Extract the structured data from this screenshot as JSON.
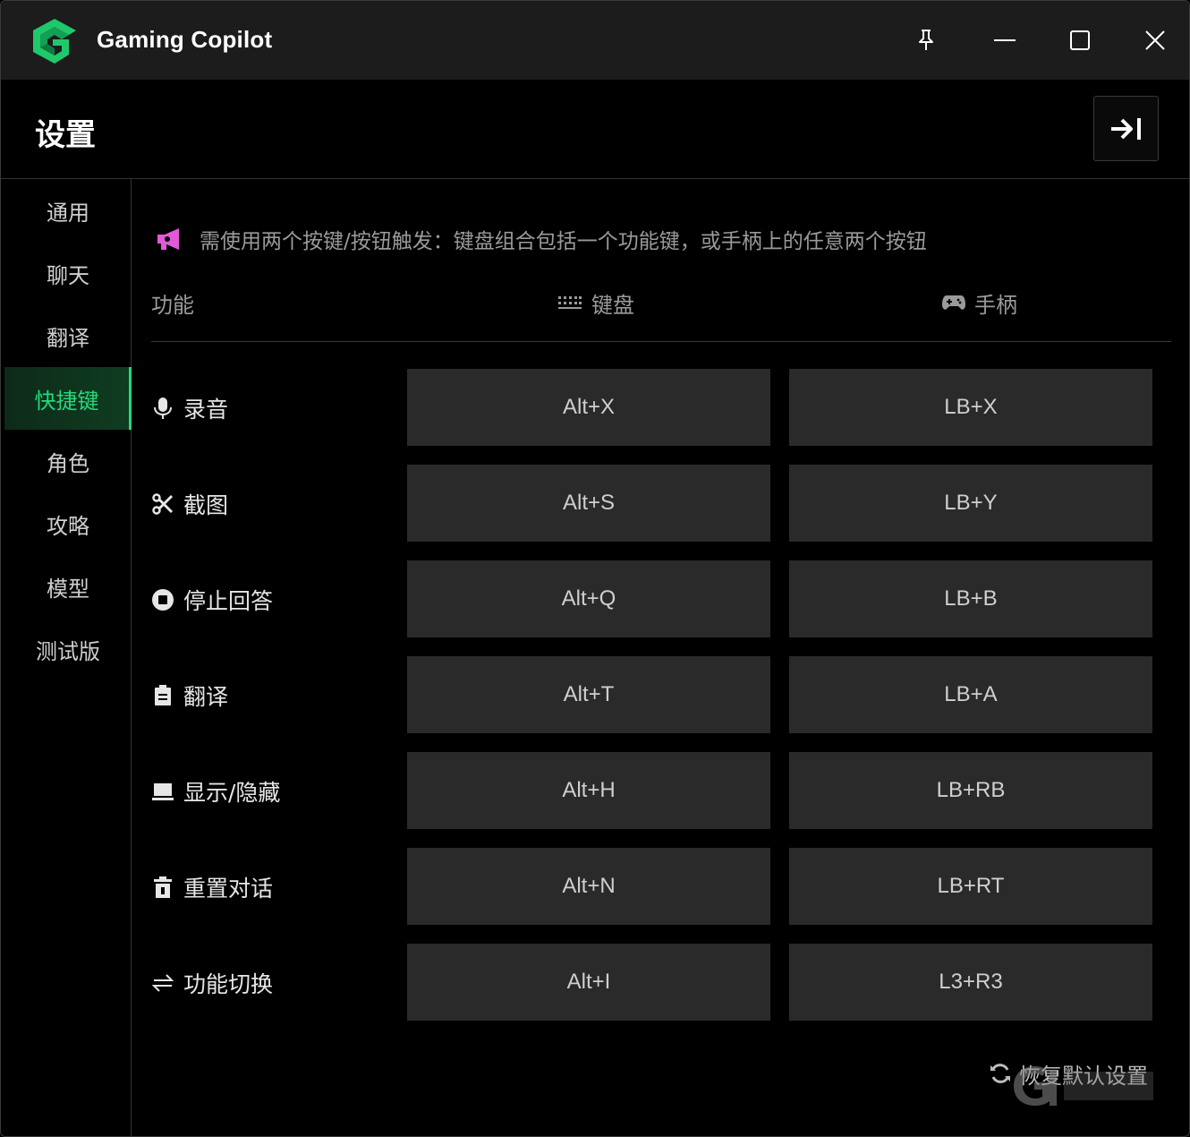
{
  "app": {
    "title": "Gaming Copilot"
  },
  "header": {
    "title": "设置"
  },
  "sidebar": {
    "items": [
      {
        "label": "通用"
      },
      {
        "label": "聊天"
      },
      {
        "label": "翻译"
      },
      {
        "label": "快捷键",
        "active": true
      },
      {
        "label": "角色"
      },
      {
        "label": "攻略"
      },
      {
        "label": "模型"
      },
      {
        "label": "测试版"
      }
    ]
  },
  "notice": {
    "text": "需使用两个按键/按钮触发：键盘组合包括一个功能键，或手柄上的任意两个按钮"
  },
  "columns": {
    "function": "功能",
    "keyboard": "键盘",
    "gamepad": "手柄"
  },
  "shortcuts": [
    {
      "label": "录音",
      "icon": "microphone-icon",
      "keyboard": "Alt+X",
      "gamepad": "LB+X"
    },
    {
      "label": "截图",
      "icon": "scissors-icon",
      "keyboard": "Alt+S",
      "gamepad": "LB+Y"
    },
    {
      "label": "停止回答",
      "icon": "stop-icon",
      "keyboard": "Alt+Q",
      "gamepad": "LB+B"
    },
    {
      "label": "翻译",
      "icon": "clipboard-icon",
      "keyboard": "Alt+T",
      "gamepad": "LB+A"
    },
    {
      "label": "显示/隐藏",
      "icon": "laptop-icon",
      "keyboard": "Alt+H",
      "gamepad": "LB+RB"
    },
    {
      "label": "重置对话",
      "icon": "trash-icon",
      "keyboard": "Alt+N",
      "gamepad": "LB+RT"
    },
    {
      "label": "功能切换",
      "icon": "switch-arrows-icon",
      "keyboard": "Alt+I",
      "gamepad": "L3+R3"
    }
  ],
  "footer": {
    "reset_label": "恢复默认设置"
  },
  "colors": {
    "accent": "#25d97a",
    "notice_icon": "#e05ad8",
    "button_bg": "#2a2a2a"
  }
}
